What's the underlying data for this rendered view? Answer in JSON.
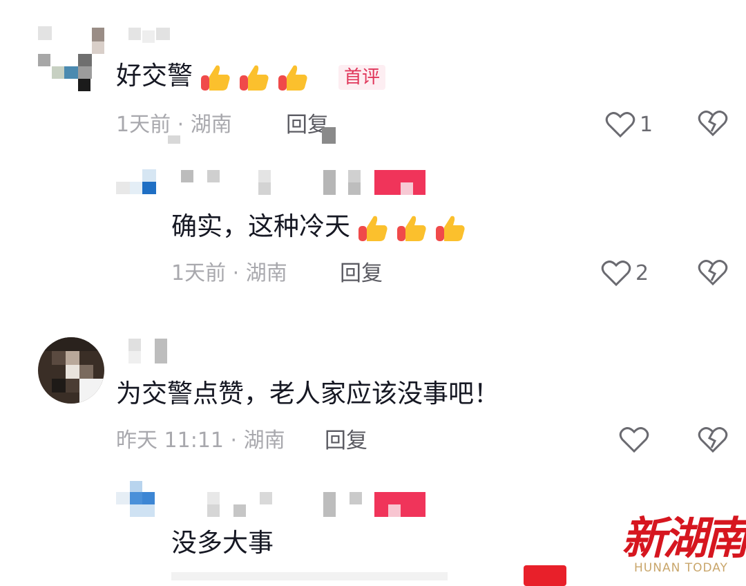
{
  "comments": [
    {
      "text": "好交警",
      "badge": "首评",
      "meta": "1天前 · 湖南",
      "reply_label": "回复",
      "likes": "1",
      "reply": {
        "text": "确实，这种冷天",
        "meta": "1天前 · 湖南",
        "reply_label": "回复",
        "likes": "2"
      }
    },
    {
      "text": "为交警点赞，老人家应该没事吧！",
      "meta": "昨天 11:11 · 湖南",
      "reply_label": "回复",
      "likes": "",
      "reply": {
        "text": "没多大事"
      }
    }
  ],
  "watermark": {
    "title": "新湖南",
    "subtitle": "HUNAN TODAY"
  },
  "colors": {
    "badge": "#e0365a",
    "watermark_red": "#d6161f",
    "pixel_pink": "#f0345a"
  },
  "icons": {
    "like": "heart-outline-icon",
    "dislike": "broken-heart-icon",
    "emoji": "thumbs-up-emoji"
  }
}
